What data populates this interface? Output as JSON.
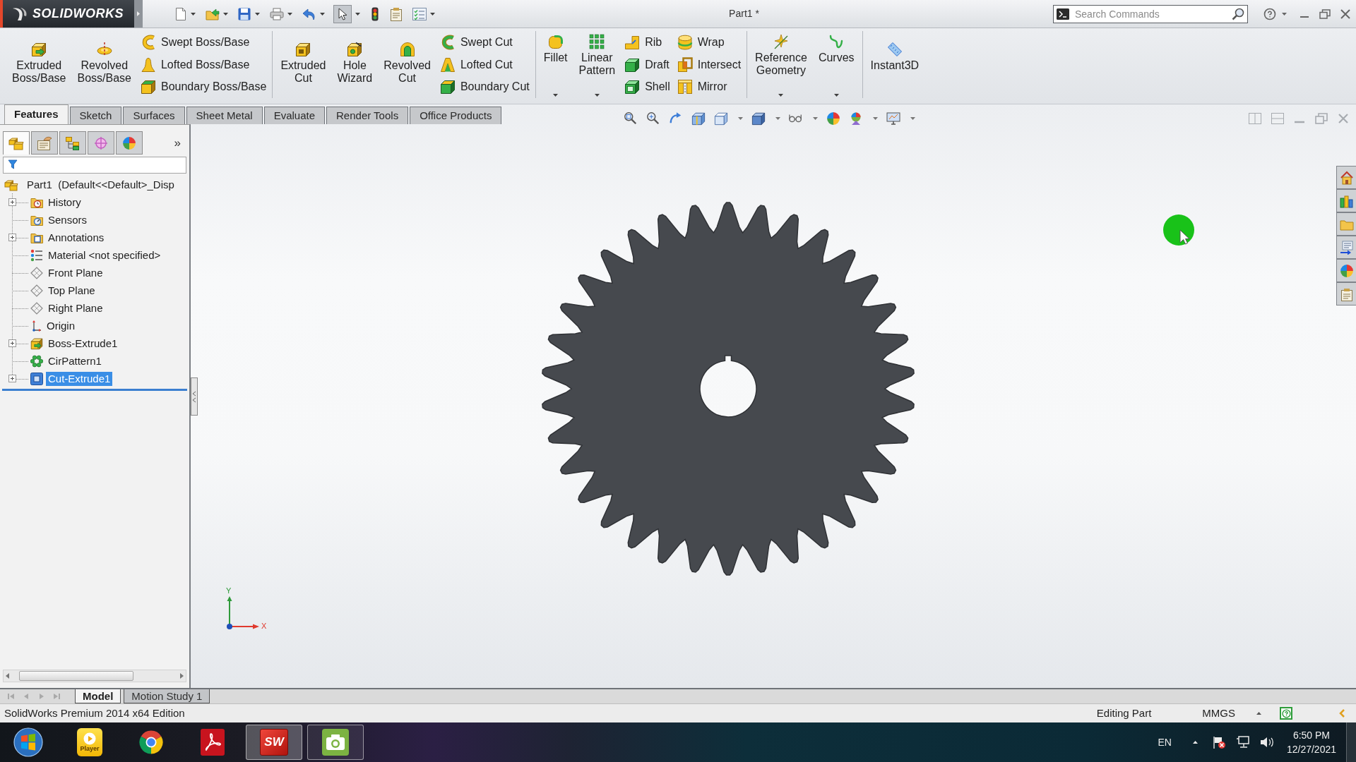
{
  "title_bar": {
    "app_name": "SOLIDWORKS",
    "document_title": "Part1 *",
    "search": {
      "placeholder": "Search Commands"
    }
  },
  "ribbon": {
    "groups": [
      {
        "columns": [
          {
            "kind": "large",
            "label": "Extruded Boss/Base",
            "dropdown": false
          },
          {
            "kind": "large",
            "label": "Revolved Boss/Base",
            "dropdown": false
          },
          {
            "kind": "stack",
            "items": [
              {
                "label": "Swept Boss/Base"
              },
              {
                "label": "Lofted Boss/Base"
              },
              {
                "label": "Boundary Boss/Base"
              }
            ]
          }
        ]
      },
      {
        "columns": [
          {
            "kind": "large",
            "label": "Extruded Cut",
            "dropdown": false
          },
          {
            "kind": "large",
            "label": "Hole Wizard",
            "dropdown": false
          },
          {
            "kind": "large",
            "label": "Revolved Cut",
            "dropdown": false
          },
          {
            "kind": "stack",
            "items": [
              {
                "label": "Swept Cut"
              },
              {
                "label": "Lofted Cut"
              },
              {
                "label": "Boundary Cut"
              }
            ]
          }
        ]
      },
      {
        "columns": [
          {
            "kind": "large",
            "label": "Fillet",
            "dropdown": true
          },
          {
            "kind": "large",
            "label": "Linear Pattern",
            "dropdown": true
          },
          {
            "kind": "stack",
            "items": [
              {
                "label": "Rib"
              },
              {
                "label": "Draft"
              },
              {
                "label": "Shell"
              }
            ]
          },
          {
            "kind": "stack",
            "items": [
              {
                "label": "Wrap"
              },
              {
                "label": "Intersect"
              },
              {
                "label": "Mirror"
              }
            ]
          }
        ]
      },
      {
        "columns": [
          {
            "kind": "large",
            "label": "Reference Geometry",
            "dropdown": true
          },
          {
            "kind": "large",
            "label": "Curves",
            "dropdown": true
          }
        ]
      },
      {
        "columns": [
          {
            "kind": "large",
            "label": "Instant3D",
            "dropdown": false
          }
        ]
      }
    ]
  },
  "command_tabs": [
    {
      "label": "Features",
      "selected": true
    },
    {
      "label": "Sketch",
      "selected": false
    },
    {
      "label": "Surfaces",
      "selected": false
    },
    {
      "label": "Sheet Metal",
      "selected": false
    },
    {
      "label": "Evaluate",
      "selected": false
    },
    {
      "label": "Render Tools",
      "selected": false
    },
    {
      "label": "Office Products",
      "selected": false
    }
  ],
  "feature_manager": {
    "panel_tabs": [
      {
        "selected": true
      },
      {
        "selected": false
      },
      {
        "selected": false
      },
      {
        "selected": false
      },
      {
        "selected": false
      }
    ],
    "more": "»",
    "tree": {
      "label": "Part1  (Default<<Default>_Disp",
      "kind": "part",
      "selected": false,
      "children": [
        {
          "label": "History",
          "kind": "history",
          "expander": true,
          "selected": false
        },
        {
          "label": "Sensors",
          "kind": "sensors",
          "expander": false,
          "selected": false
        },
        {
          "label": "Annotations",
          "kind": "annotations",
          "expander": true,
          "selected": false
        },
        {
          "label": "Material <not specified>",
          "kind": "material",
          "expander": false,
          "selected": false
        },
        {
          "label": "Front Plane",
          "kind": "plane",
          "expander": false,
          "selected": false
        },
        {
          "label": "Top Plane",
          "kind": "plane",
          "expander": false,
          "selected": false
        },
        {
          "label": "Right Plane",
          "kind": "plane",
          "expander": false,
          "selected": false
        },
        {
          "label": "Origin",
          "kind": "origin",
          "expander": false,
          "selected": false
        },
        {
          "label": "Boss-Extrude1",
          "kind": "extrude",
          "expander": true,
          "selected": false
        },
        {
          "label": "CirPattern1",
          "kind": "pattern",
          "expander": false,
          "selected": false
        },
        {
          "label": "Cut-Extrude1",
          "kind": "cut",
          "expander": true,
          "selected": true
        }
      ]
    }
  },
  "viewport": {
    "triad": {
      "y_label": "Y",
      "x_label": "X"
    }
  },
  "bottom_tabs": [
    {
      "label": "Model",
      "selected": true
    },
    {
      "label": "Motion Study 1",
      "selected": false
    }
  ],
  "status_bar": {
    "edition": "SolidWorks Premium 2014 x64 Edition",
    "mode": "Editing Part",
    "units": "MMGS"
  },
  "taskbar": {
    "apps": [
      {
        "kind": "player",
        "text": "Player",
        "running": false,
        "selected": false
      },
      {
        "kind": "browser",
        "running": false,
        "selected": false
      },
      {
        "kind": "pdf",
        "running": false,
        "selected": false
      },
      {
        "kind": "solidworks",
        "text": "SW",
        "running": true,
        "selected": true
      },
      {
        "kind": "camera",
        "running": true,
        "selected": false
      }
    ],
    "language": "EN",
    "time": "6:50 PM",
    "date": "12/27/2021"
  }
}
